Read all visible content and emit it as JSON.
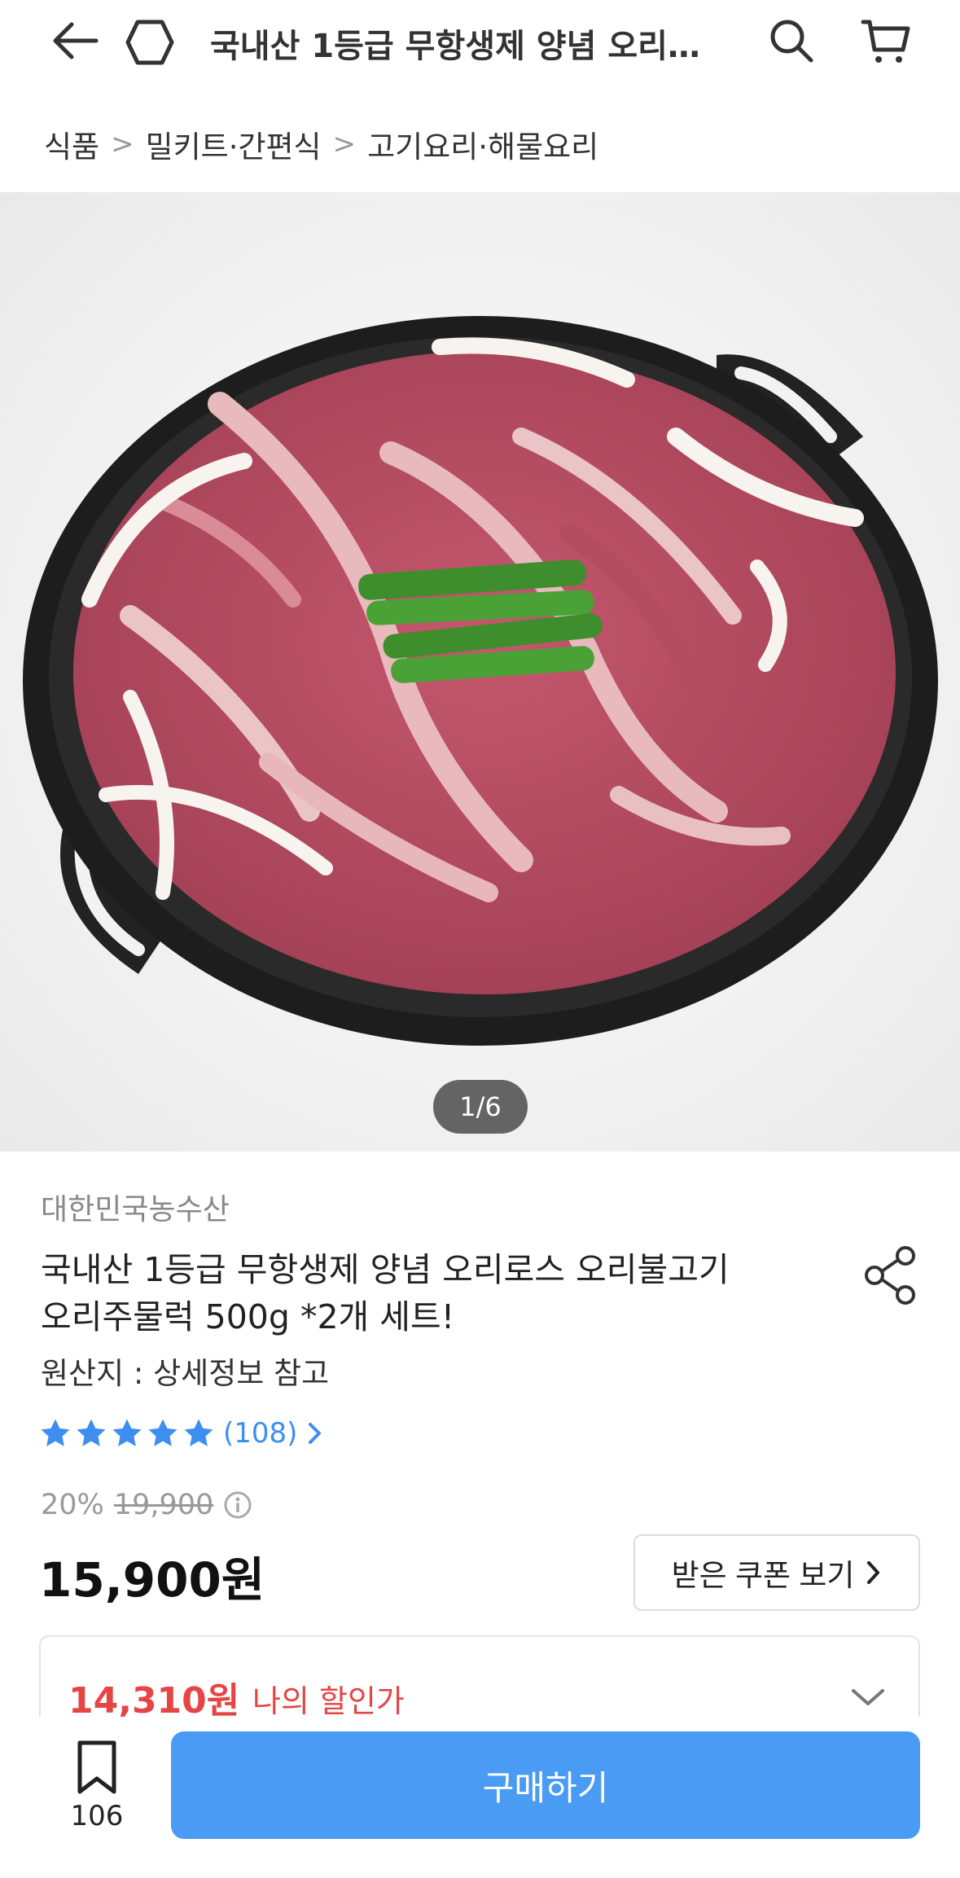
{
  "header": {
    "title": "국내산 1등급 무항생제  양념 오리…"
  },
  "breadcrumb": {
    "items": [
      "식품",
      "밀키트·간편식",
      "고기요리·해물요리"
    ]
  },
  "gallery": {
    "counter": "1/6"
  },
  "product": {
    "seller": "대한민국농수산",
    "name_line1": "국내산 1등급 무항생제  양념 오리로스 오리불고기",
    "name_line2": "오리주물럭 500g *2개 세트!",
    "origin": "원산지 : 상세정보 참고",
    "rating": {
      "stars": 5,
      "reviews": "(108)"
    },
    "discount_rate": "20%",
    "original_price": "19,900",
    "price": "15,900원",
    "coupon_button": "받은 쿠폰 보기",
    "my_price": "14,310원",
    "my_price_label": "나의 할인가"
  },
  "bottom_bar": {
    "bookmark_count": "106",
    "buy_button": "구매하기"
  },
  "colors": {
    "accent": "#4a9bf4",
    "link": "#3d8ef0",
    "sale_red": "#e64545",
    "star": "#3d8ef0"
  },
  "icons": [
    "back-icon",
    "home-icon",
    "search-icon",
    "cart-icon",
    "share-icon",
    "star-icon",
    "info-icon",
    "chevron-down-icon",
    "bookmark-icon"
  ]
}
